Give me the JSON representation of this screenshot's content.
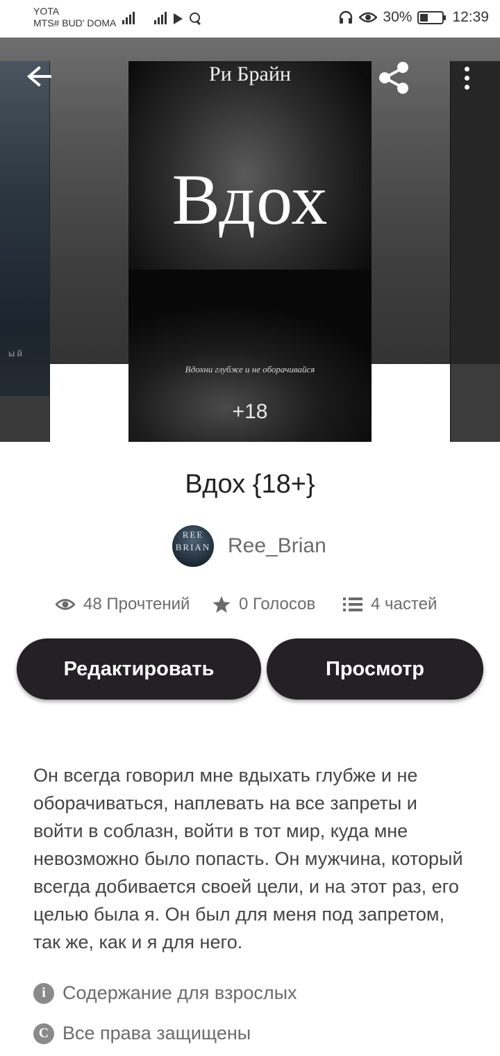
{
  "status_bar": {
    "carrier_1": "YOTA",
    "carrier_2": "MTS# BUD' DOMA",
    "battery": "30%",
    "time": "12:39"
  },
  "cover": {
    "author": "Ри Брайн",
    "title": "Вдох",
    "tagline": "Вдохни глубже и не оборачивайся",
    "age": "+18",
    "left_fragment": "ый"
  },
  "story": {
    "title": "Вдох {18+}",
    "author": "Ree_Brian",
    "avatar_line1": "REE",
    "avatar_line2": "BRIAN"
  },
  "stats": {
    "reads": "48 Прочтений",
    "votes": "0 Голосов",
    "parts": "4 частей"
  },
  "buttons": {
    "edit": "Редактировать",
    "preview": "Просмотр"
  },
  "description": "Он всегда говорил мне вдыхать глубже и не оборачиваться, наплевать на все запреты и войти в соблазн, войти в тот мир, куда мне невозможно было попасть. Он мужчина, который всегда добивается своей цели, и на этот раз, его целью была я. Он был для меня под запретом, так же, как и я для него.",
  "meta": {
    "mature": "Содержание для взрослых",
    "copyright": "Все права защищены",
    "mature_icon": "i",
    "copyright_icon": "C"
  }
}
